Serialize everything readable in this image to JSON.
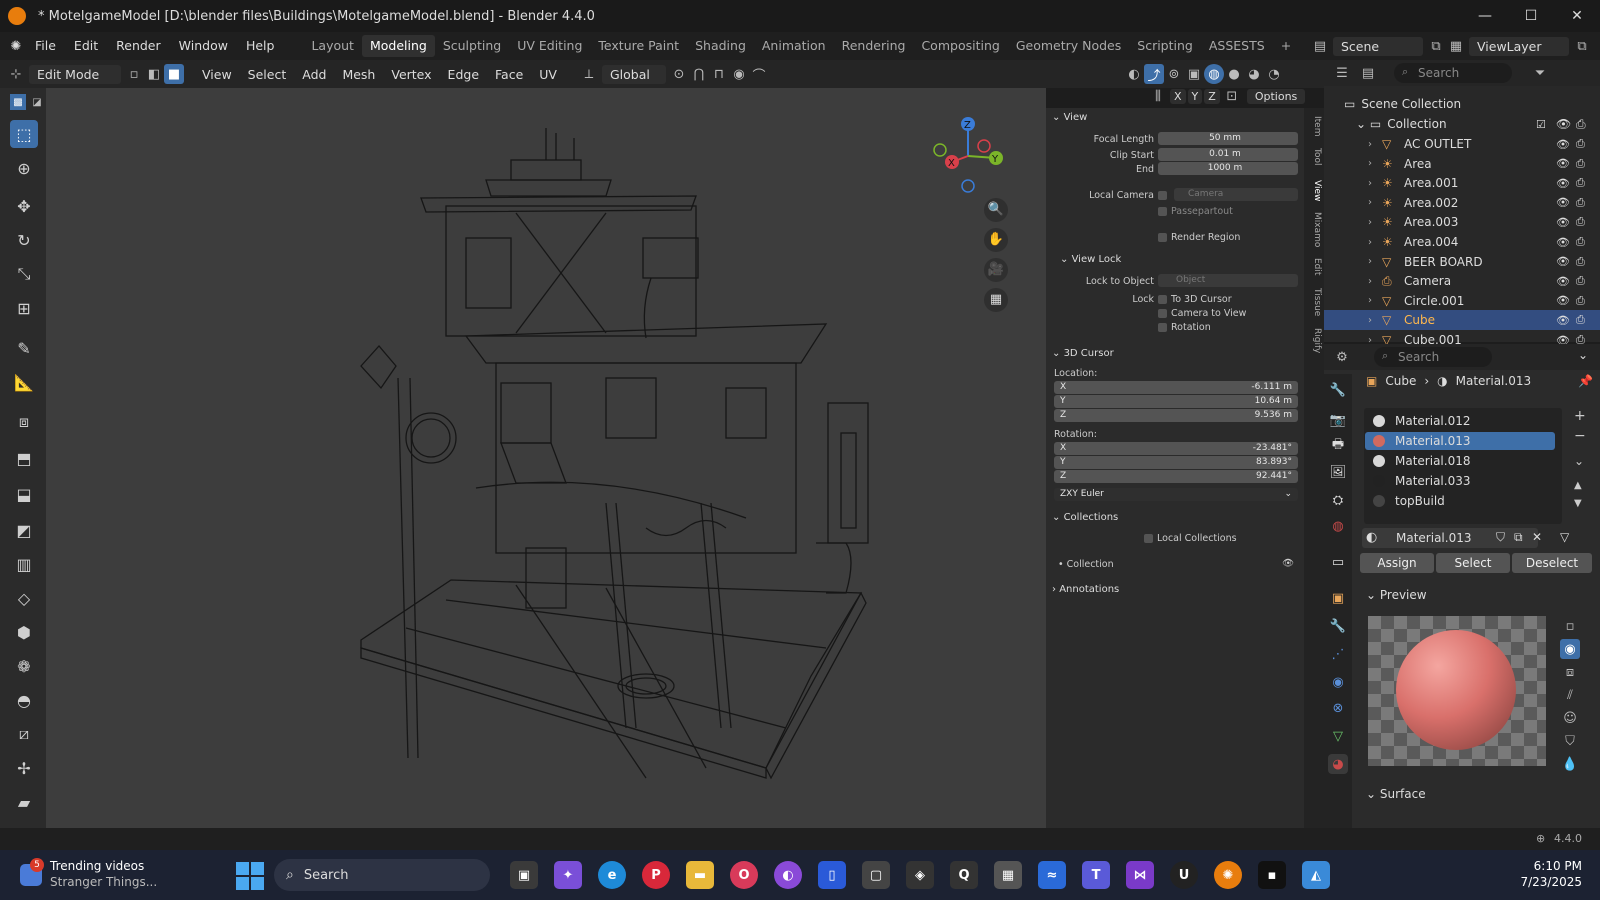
{
  "window": {
    "title": "* MotelgameModel [D:\\blender files\\Buildings\\MotelgameModel.blend] - Blender 4.4.0",
    "minimize": "—",
    "maximize": "☐",
    "close": "✕"
  },
  "menu": [
    "File",
    "Edit",
    "Render",
    "Window",
    "Help"
  ],
  "workspaces": [
    "Layout",
    "Modeling",
    "Sculpting",
    "UV Editing",
    "Texture Paint",
    "Shading",
    "Animation",
    "Rendering",
    "Compositing",
    "Geometry Nodes",
    "Scripting",
    "ASSESTS",
    "+"
  ],
  "active_workspace": "Modeling",
  "scene": {
    "name": "Scene",
    "view_layer": "ViewLayer"
  },
  "header": {
    "mode": "Edit Mode",
    "menus": [
      "View",
      "Select",
      "Add",
      "Mesh",
      "Vertex",
      "Edge",
      "Face",
      "UV"
    ],
    "transform": "Global",
    "options": "Options",
    "axes": [
      "X",
      "Y",
      "Z"
    ]
  },
  "npanel": {
    "view_title": "View",
    "focal_length_label": "Focal Length",
    "focal_length": "50 mm",
    "clip_start_label": "Clip Start",
    "clip_start": "0.01 m",
    "end_label": "End",
    "end": "1000 m",
    "local_camera_label": "Local Camera",
    "camera_placeholder": "Camera",
    "passepartout": "Passepartout",
    "render_region": "Render Region",
    "view_lock_title": "View Lock",
    "lock_to_object_label": "Lock to Object",
    "object_placeholder": "Object",
    "lock_label": "Lock",
    "lock_options": [
      "To 3D Cursor",
      "Camera to View",
      "Rotation"
    ],
    "cursor_title": "3D Cursor",
    "location_label": "Location:",
    "location": [
      {
        "axis": "X",
        "value": "-6.111 m"
      },
      {
        "axis": "Y",
        "value": "10.64 m"
      },
      {
        "axis": "Z",
        "value": "9.536 m"
      }
    ],
    "rotation_label": "Rotation:",
    "rotation": [
      {
        "axis": "X",
        "value": "-23.481°"
      },
      {
        "axis": "Y",
        "value": "83.893°"
      },
      {
        "axis": "Z",
        "value": "92.441°"
      }
    ],
    "rotation_mode": "ZXY Euler",
    "collections_title": "Collections",
    "local_collections": "Local Collections",
    "collection_item": "Collection",
    "annotations_title": "Annotations",
    "tabs": [
      "Item",
      "Tool",
      "View",
      "Mixamo",
      "Edit",
      "Tissue",
      "Rigify"
    ]
  },
  "outliner": {
    "search_placeholder": "Search",
    "root": "Scene Collection",
    "collection": "Collection",
    "items": [
      "AC OUTLET",
      "Area",
      "Area.001",
      "Area.002",
      "Area.003",
      "Area.004",
      "BEER BOARD",
      "Camera",
      "Circle.001",
      "Cube",
      "Cube.001"
    ],
    "selected": "Cube"
  },
  "properties": {
    "search_placeholder": "Search",
    "breadcrumb_object": "Cube",
    "breadcrumb_material": "Material.013",
    "slots": [
      "Material.012",
      "Material.013",
      "Material.018",
      "Material.033",
      "topBuild"
    ],
    "slot_colors": [
      "#d8d8d8",
      "#d06a5f",
      "#d8d8d8",
      "#222222",
      "#444444"
    ],
    "active_slot": "Material.013",
    "material_name": "Material.013",
    "assign": "Assign",
    "select": "Select",
    "deselect": "Deselect",
    "preview_title": "Preview",
    "surface_title": "Surface",
    "preview_color": "#d9706b"
  },
  "status": {
    "version": "4.4.0"
  },
  "taskbar": {
    "notification_count": "5",
    "trending_title": "Trending videos",
    "trending_sub": "Stranger Things...",
    "search": "Search",
    "time": "6:10 PM",
    "date": "7/23/2025"
  }
}
